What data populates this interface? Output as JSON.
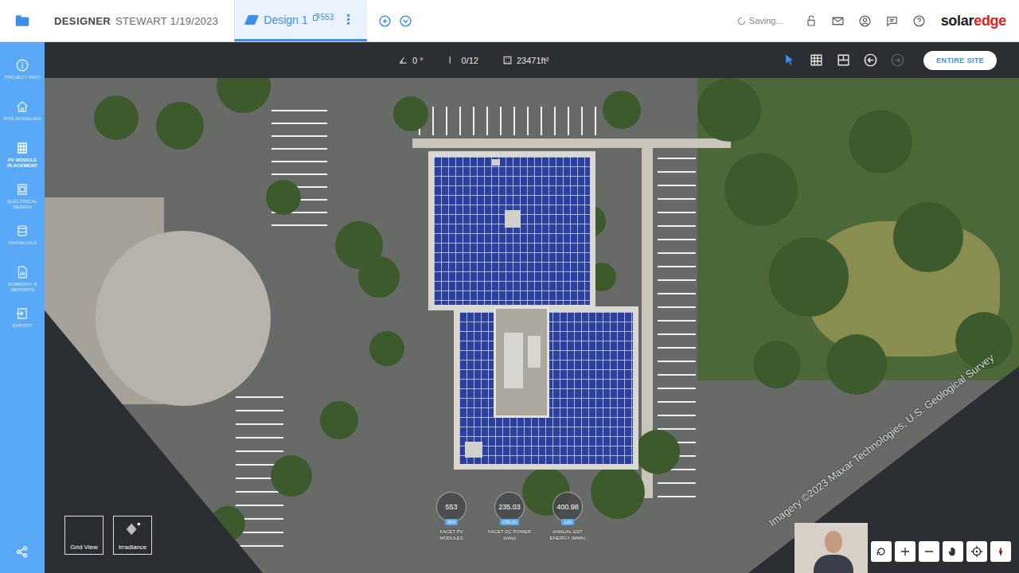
{
  "header": {
    "app": "DESIGNER",
    "project": "STEWART 1/19/2023",
    "tab": {
      "label": "Design 1",
      "count": "553",
      "selected": true
    },
    "tab_menu": "⋮",
    "status": "Saving...",
    "logo": {
      "main": "solar",
      "accent": "edge"
    }
  },
  "sidebar": {
    "items": [
      {
        "label": "PROJECT INFO",
        "selected": false
      },
      {
        "label": "SITE MODELING",
        "selected": false
      },
      {
        "label": "PV MODULE PLACEMENT",
        "selected": true
      },
      {
        "label": "ELECTRICAL DESIGN",
        "selected": false
      },
      {
        "label": "FINANCIALS",
        "selected": false
      },
      {
        "label": "SUMMARY & REPORTS",
        "selected": false
      },
      {
        "label": "EXPORT",
        "selected": false
      }
    ]
  },
  "toolbar": {
    "readouts": [
      {
        "value": "0 °"
      },
      {
        "value": "0/12"
      },
      {
        "value": "23471ft²"
      }
    ],
    "tools": [
      {
        "name": "select",
        "selected": true,
        "disabled": false
      },
      {
        "name": "module-grid",
        "selected": false,
        "disabled": false
      },
      {
        "name": "panel",
        "selected": false,
        "disabled": false
      },
      {
        "name": "undo",
        "selected": false,
        "disabled": false
      },
      {
        "name": "redo",
        "selected": false,
        "disabled": true
      }
    ],
    "button": "ENTIRE SITE"
  },
  "stats": [
    {
      "value": "553",
      "badge": "553",
      "label": "FACET PV MODULES"
    },
    {
      "value": "235.03",
      "badge": "235.03",
      "label": "FACET DC POWER (kWp)"
    },
    {
      "value": "400.98",
      "badge": "120",
      "label": "ANNUAL EST ENERGY (MWh)"
    }
  ],
  "view_toggles": [
    {
      "label": "Grid View",
      "selected": false
    },
    {
      "label": "Irradiance",
      "selected": false
    }
  ],
  "attribution": "Imagery ©2023 Maxar Technologies, U.S. Geological Survey"
}
